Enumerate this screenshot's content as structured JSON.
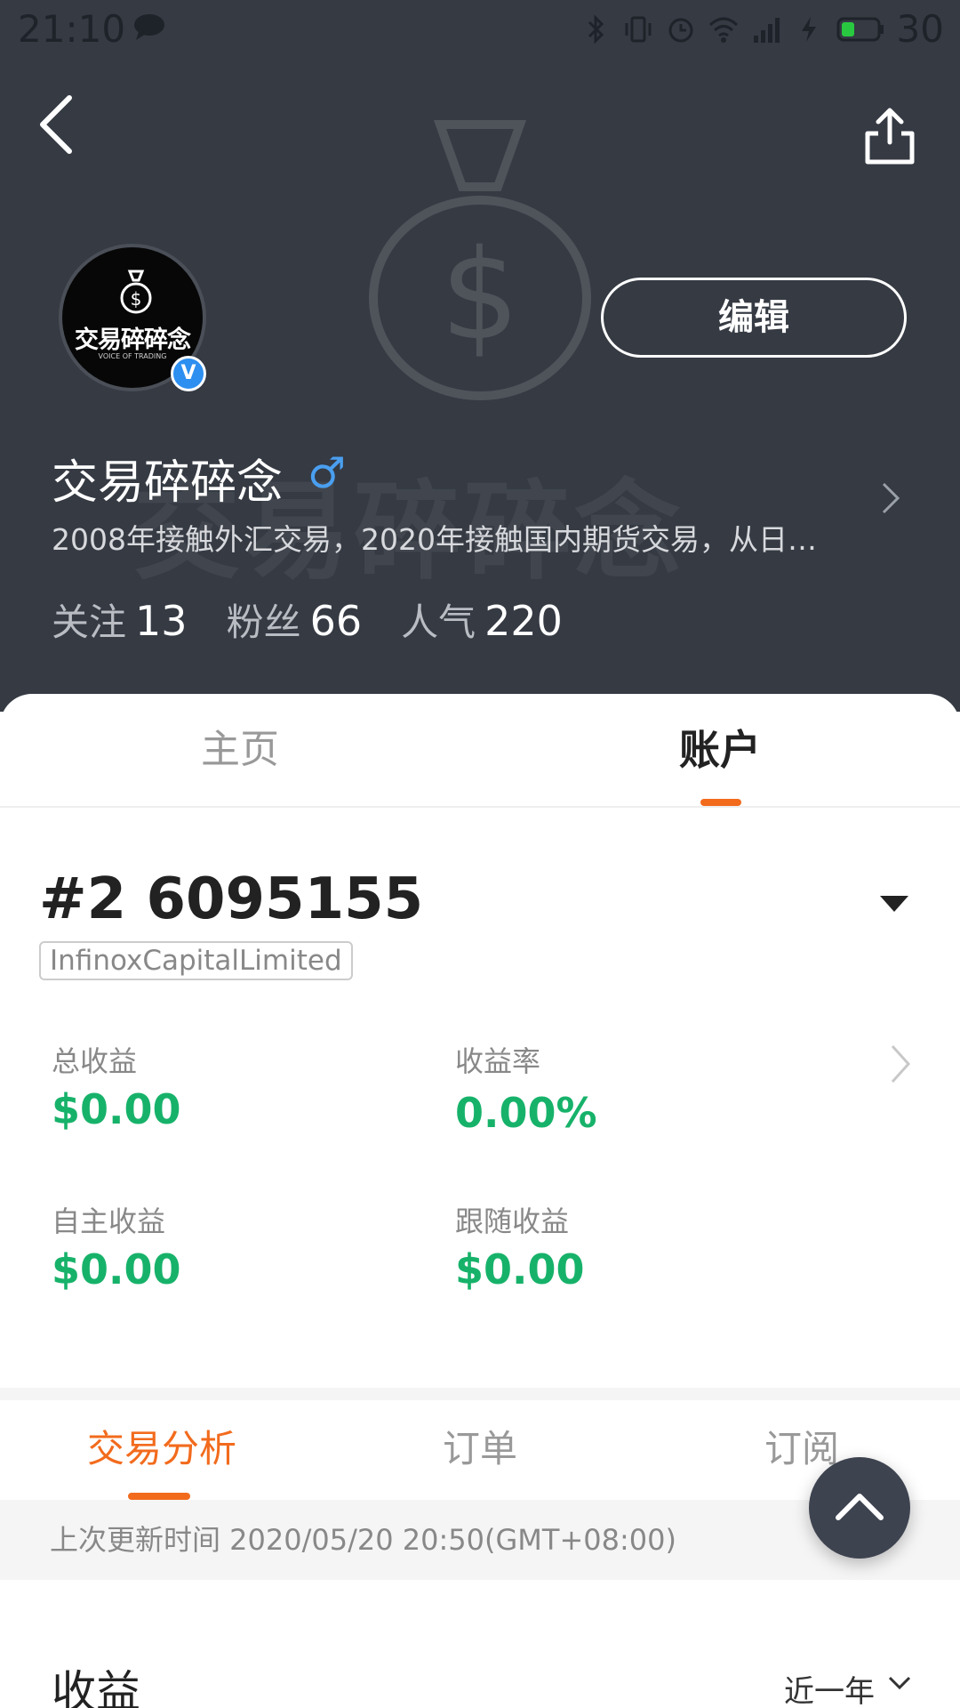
{
  "status_bar": {
    "time": "21:10",
    "battery_level": "30",
    "icons": [
      "chat-icon",
      "bluetooth-icon",
      "vibrate-icon",
      "alarm-icon",
      "wifi-icon",
      "signal-4g-icon",
      "charging-icon",
      "battery-icon"
    ]
  },
  "header": {
    "edit_label": "编辑",
    "username": "交易碎碎念",
    "gender_symbol": "♂",
    "bio": "2008年接触外汇交易，2020年接触国内期货交易，从日…",
    "avatar_logo_text": "交易碎碎念",
    "avatar_logo_sub": "VOICE OF TRADING",
    "verified_label": "V",
    "stats": [
      {
        "label": "关注",
        "value": "13"
      },
      {
        "label": "粉丝",
        "value": "66"
      },
      {
        "label": "人气",
        "value": "220"
      }
    ]
  },
  "tabs": {
    "main": "主页",
    "account": "账户",
    "active": "account"
  },
  "account": {
    "number": "#2 6095155",
    "broker": "InfinoxCapitalLimited",
    "metrics": [
      {
        "label": "总收益",
        "value": "$0.00"
      },
      {
        "label": "收益率",
        "value": "0.00%"
      },
      {
        "label": "自主收益",
        "value": "$0.00"
      },
      {
        "label": "跟随收益",
        "value": "$0.00"
      }
    ]
  },
  "sub_tabs": {
    "items": [
      "交易分析",
      "订单",
      "订阅"
    ],
    "active": "交易分析"
  },
  "last_update": "上次更新时间 2020/05/20 20:50(GMT+08:00)",
  "earnings_section": {
    "title": "收益",
    "period": "近一年"
  },
  "colors": {
    "header_bg": "#353a43",
    "accent_orange": "#f26b1d",
    "positive_green": "#17b26a",
    "verified_blue": "#2d8ff0",
    "gender_blue": "#4a9ff0"
  }
}
